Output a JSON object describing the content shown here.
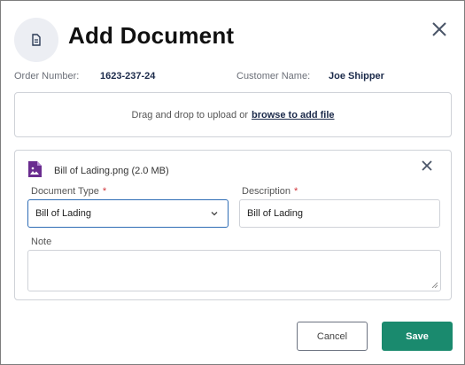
{
  "header": {
    "title": "Add Document",
    "icon": "document-icon",
    "close_icon": "close-icon"
  },
  "order": {
    "order_number_label": "Order Number:",
    "order_number": "1623-237-24",
    "customer_name_label": "Customer Name:",
    "customer_name": "Joe Shipper"
  },
  "dropzone": {
    "text": "Drag and drop to upload or",
    "link": "browse to add file"
  },
  "file": {
    "icon": "image-file-icon",
    "name": "Bill of Lading.png (2.0 MB)",
    "remove_icon": "close-icon",
    "document_type_label": "Document Type",
    "document_type_required": "*",
    "document_type_value": "Bill of Lading",
    "description_label": "Description",
    "description_required": "*",
    "description_value": "Bill of Lading",
    "note_label": "Note",
    "note_value": ""
  },
  "footer": {
    "cancel_label": "Cancel",
    "save_label": "Save"
  },
  "colors": {
    "primary": "#1a8a6e",
    "focus_border": "#2f6db5",
    "required": "#d0343a",
    "file_icon": "#6a2c8f"
  }
}
